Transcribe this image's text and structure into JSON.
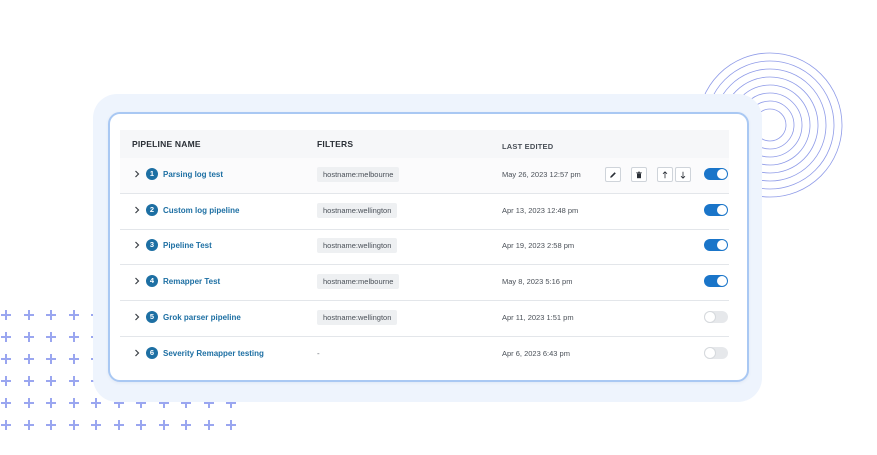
{
  "colors": {
    "accent": "#1a75c9",
    "link": "#1d6fa3",
    "frame": "#eef4fd",
    "card_border": "#a9c8f3",
    "decoration": "#9aa6f0"
  },
  "table": {
    "headers": {
      "name": "PIPELINE NAME",
      "filters": "FILTERS",
      "edited": "LAST EDITED"
    },
    "rows": [
      {
        "index": "1",
        "name": "Parsing log test",
        "filter": "hostname:melbourne",
        "edited": "May 26, 2023 12:57 pm",
        "enabled": true,
        "show_actions": true
      },
      {
        "index": "2",
        "name": "Custom log pipeline",
        "filter": "hostname:wellington",
        "edited": "Apr 13, 2023 12:48 pm",
        "enabled": true,
        "show_actions": false
      },
      {
        "index": "3",
        "name": "Pipeline Test",
        "filter": "hostname:wellington",
        "edited": "Apr 19, 2023 2:58 pm",
        "enabled": true,
        "show_actions": false
      },
      {
        "index": "4",
        "name": "Remapper Test",
        "filter": "hostname:melbourne",
        "edited": "May 8, 2023 5:16 pm",
        "enabled": true,
        "show_actions": false
      },
      {
        "index": "5",
        "name": "Grok parser pipeline",
        "filter": "hostname:wellington",
        "edited": "Apr 11, 2023 1:51 pm",
        "enabled": false,
        "show_actions": false
      },
      {
        "index": "6",
        "name": "Severity Remapper testing",
        "filter": "-",
        "edited": "Apr 6, 2023 6:43 pm",
        "enabled": false,
        "show_actions": false
      }
    ],
    "row_icons": {
      "expand": "chevron-right-icon",
      "actions": [
        "pencil-icon",
        "trash-icon",
        "arrow-up-icon",
        "arrow-down-icon"
      ]
    }
  }
}
